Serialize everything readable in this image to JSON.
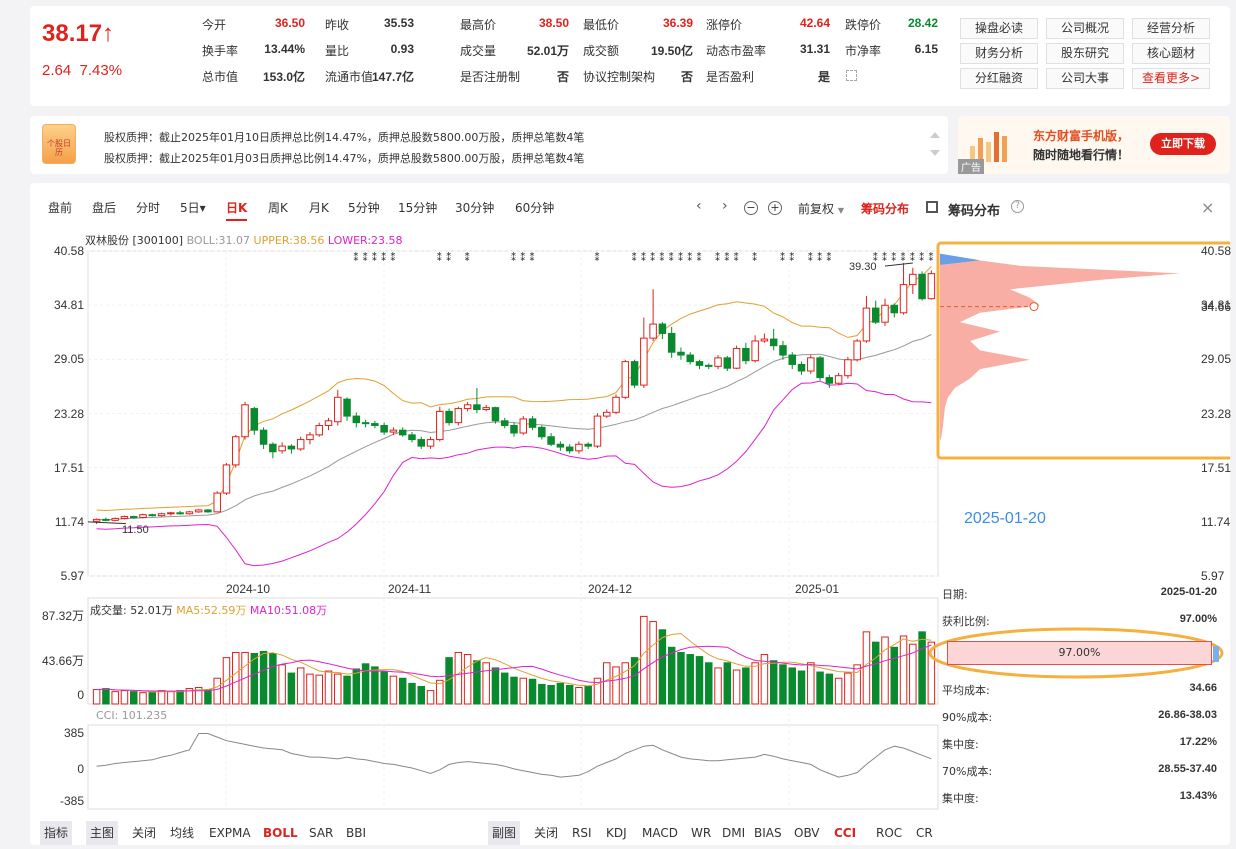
{
  "quote": {
    "price": "38.17↑",
    "change": "2.64",
    "change_pct": "7.43%",
    "items": [
      {
        "label": "今开",
        "value": "36.50",
        "cls": "red"
      },
      {
        "label": "昨收",
        "value": "35.53",
        "cls": ""
      },
      {
        "label": "最高价",
        "value": "38.50",
        "cls": "red"
      },
      {
        "label": "最低价",
        "value": "36.39",
        "cls": "red"
      },
      {
        "label": "涨停价",
        "value": "42.64",
        "cls": "red"
      },
      {
        "label": "跌停价",
        "value": "28.42",
        "cls": "green"
      },
      {
        "label": "换手率",
        "value": "13.44%",
        "cls": ""
      },
      {
        "label": "量比",
        "value": "0.93",
        "cls": ""
      },
      {
        "label": "成交量",
        "value": "52.01万",
        "cls": ""
      },
      {
        "label": "成交额",
        "value": "19.50亿",
        "cls": ""
      },
      {
        "label": "动态市盈率",
        "value": "31.31",
        "cls": ""
      },
      {
        "label": "市净率",
        "value": "6.15",
        "cls": ""
      },
      {
        "label": "总市值",
        "value": "153.0亿",
        "cls": ""
      },
      {
        "label": "流通市值",
        "value": "147.7亿",
        "cls": ""
      },
      {
        "label": "是否注册制",
        "value": "否",
        "cls": ""
      },
      {
        "label": "协议控制架构",
        "value": "否",
        "cls": ""
      },
      {
        "label": "是否盈利",
        "value": "是",
        "cls": ""
      },
      {
        "label": "",
        "value": "",
        "cls": ""
      }
    ]
  },
  "links": [
    "操盘必读",
    "公司概况",
    "经营分析",
    "财务分析",
    "股东研究",
    "核心题材",
    "分红融资",
    "公司大事",
    "查看更多>"
  ],
  "pledge": {
    "icon_text": "个股日历",
    "lines": [
      "股权质押：截止2025年01月10日质押总比例14.47%，质押总股数5800.00万股，质押总笔数4笔",
      "股权质押：截止2025年01月03日质押总比例14.47%，质押总股数5800.00万股，质押总笔数4笔"
    ]
  },
  "ad": {
    "line1": "东方财富手机版，",
    "line2": "随时随地看行情！",
    "button": "立即下载",
    "tag": "广告"
  },
  "periods": [
    "盘前",
    "盘后",
    "分时",
    "5日▾",
    "日K",
    "周K",
    "月K",
    "5分钟",
    "15分钟",
    "30分钟",
    "60分钟"
  ],
  "active_period": "日K",
  "toolbar": {
    "fq": "前复权",
    "chip": "筹码分布",
    "chip_title": "筹码分布",
    "close": "×"
  },
  "legend": {
    "name": "双林股份 [300100]",
    "boll": "BOLL:31.07",
    "upper": "UPPER:38.56",
    "lower": "LOWER:23.58"
  },
  "colors": {
    "up": "#e0221c",
    "down": "#0a8a2e",
    "upper": "#e0a030",
    "mid": "#999999",
    "lower": "#e020d0",
    "ma5": "#e0a030",
    "ma10": "#e020d0"
  },
  "price_axis": [
    "40.58",
    "34.81",
    "29.05",
    "23.28",
    "17.51",
    "11.74",
    "5.97"
  ],
  "date_axis": [
    "2024-10",
    "2024-11",
    "2024-12",
    "2025-01"
  ],
  "annot": {
    "high": "39.30",
    "low": "11.50",
    "chip_date": "2025-01-20",
    "chip_avg": "34.66"
  },
  "vol": {
    "title": "成交量: 52.01万",
    "ma5": "MA5:52.59万",
    "ma10": "MA10:51.08万",
    "axis": [
      "87.32万",
      "43.66万",
      "0"
    ]
  },
  "cci": {
    "title": "CCI: 101.235",
    "axis": [
      "385",
      "0",
      "-385"
    ]
  },
  "chip_stats": [
    {
      "k": "日期:",
      "v": "2025-01-20"
    },
    {
      "k": "获利比例:",
      "v": "97.00%"
    },
    {
      "k": "平均成本:",
      "v": "34.66"
    },
    {
      "k": "90%成本:",
      "v": "26.86-38.03"
    },
    {
      "k": "集中度:",
      "v": "17.22%"
    },
    {
      "k": "70%成本:",
      "v": "28.55-37.40"
    },
    {
      "k": "集中度:",
      "v": "13.43%"
    }
  ],
  "profit_bar": "97.00%",
  "bottom_left": [
    "指标",
    "主图",
    "关闭",
    "均线",
    "EXPMA",
    "BOLL",
    "SAR",
    "BBI"
  ],
  "bottom_right": [
    "副图",
    "关闭",
    "RSI",
    "KDJ",
    "MACD",
    "WR",
    "DMI",
    "BIAS",
    "OBV",
    "CCI",
    "ROC",
    "CR"
  ],
  "bottom_active": [
    "BOLL",
    "CCI"
  ],
  "chart_data": {
    "type": "candlestick",
    "ylim": [
      5.97,
      40.58
    ],
    "candles": [
      [
        11.8,
        12.0,
        11.5,
        12.1
      ],
      [
        12.0,
        11.9,
        11.8,
        12.2
      ],
      [
        11.9,
        12.1,
        11.8,
        12.2
      ],
      [
        12.1,
        12.3,
        12.0,
        12.4
      ],
      [
        12.3,
        12.2,
        12.1,
        12.4
      ],
      [
        12.2,
        12.5,
        12.1,
        12.6
      ],
      [
        12.5,
        12.4,
        12.3,
        12.6
      ],
      [
        12.4,
        12.6,
        12.3,
        12.7
      ],
      [
        12.6,
        12.7,
        12.4,
        12.8
      ],
      [
        12.7,
        12.6,
        12.5,
        12.9
      ],
      [
        12.6,
        12.8,
        12.5,
        12.9
      ],
      [
        12.8,
        13.0,
        12.7,
        13.1
      ],
      [
        13.0,
        12.8,
        12.7,
        13.1
      ],
      [
        12.8,
        14.8,
        12.8,
        15.0
      ],
      [
        14.8,
        17.8,
        14.6,
        18.0
      ],
      [
        17.8,
        20.8,
        17.5,
        21.0
      ],
      [
        20.8,
        24.2,
        20.5,
        24.5
      ],
      [
        23.8,
        21.5,
        21.0,
        24.0
      ],
      [
        21.5,
        20.0,
        19.5,
        21.8
      ],
      [
        20.0,
        19.2,
        18.5,
        20.2
      ],
      [
        19.3,
        19.8,
        19.0,
        20.2
      ],
      [
        19.8,
        19.5,
        19.0,
        20.0
      ],
      [
        19.5,
        20.5,
        19.3,
        20.8
      ],
      [
        20.5,
        21.0,
        20.0,
        21.3
      ],
      [
        21.0,
        22.0,
        20.8,
        22.3
      ],
      [
        22.0,
        22.5,
        21.5,
        22.8
      ],
      [
        22.4,
        25.0,
        22.0,
        25.8
      ],
      [
        24.8,
        23.0,
        22.5,
        25.0
      ],
      [
        23.0,
        22.3,
        21.8,
        23.4
      ],
      [
        22.3,
        22.2,
        21.8,
        22.6
      ],
      [
        22.2,
        22.0,
        21.7,
        22.5
      ],
      [
        22.0,
        21.3,
        21.0,
        22.3
      ],
      [
        21.3,
        21.5,
        21.0,
        21.8
      ],
      [
        21.5,
        21.0,
        20.8,
        21.8
      ],
      [
        21.0,
        20.5,
        20.2,
        21.3
      ],
      [
        20.5,
        19.8,
        19.5,
        20.8
      ],
      [
        19.8,
        20.5,
        19.5,
        20.8
      ],
      [
        20.5,
        23.5,
        20.3,
        24.0
      ],
      [
        23.5,
        22.3,
        22.0,
        23.8
      ],
      [
        22.3,
        23.8,
        22.0,
        24.0
      ],
      [
        23.8,
        24.2,
        23.5,
        24.5
      ],
      [
        24.2,
        23.7,
        23.3,
        26.0
      ],
      [
        23.7,
        23.9,
        23.5,
        24.2
      ],
      [
        23.9,
        22.5,
        22.2,
        24.0
      ],
      [
        22.5,
        22.0,
        21.7,
        22.8
      ],
      [
        22.0,
        21.2,
        20.8,
        22.3
      ],
      [
        21.2,
        22.7,
        21.0,
        23.0
      ],
      [
        22.7,
        21.8,
        21.5,
        23.0
      ],
      [
        21.8,
        20.8,
        20.5,
        22.0
      ],
      [
        20.8,
        20.0,
        19.8,
        21.2
      ],
      [
        20.0,
        19.7,
        19.3,
        20.3
      ],
      [
        19.7,
        19.3,
        19.0,
        20.0
      ],
      [
        19.3,
        20.0,
        19.0,
        20.3
      ],
      [
        20.0,
        19.8,
        19.5,
        20.2
      ],
      [
        19.8,
        23.0,
        19.6,
        23.3
      ],
      [
        23.0,
        23.4,
        22.8,
        23.7
      ],
      [
        23.4,
        25.0,
        23.2,
        25.3
      ],
      [
        25.0,
        28.8,
        24.8,
        29.0
      ],
      [
        28.8,
        26.3,
        26.0,
        29.0
      ],
      [
        26.3,
        31.3,
        26.0,
        33.5
      ],
      [
        31.3,
        32.8,
        31.0,
        36.5
      ],
      [
        32.8,
        31.8,
        31.2,
        33.0
      ],
      [
        31.8,
        29.8,
        29.2,
        32.5
      ],
      [
        29.8,
        29.5,
        29.0,
        30.3
      ],
      [
        29.5,
        28.8,
        28.5,
        29.8
      ],
      [
        28.8,
        28.4,
        28.0,
        29.0
      ],
      [
        28.4,
        28.3,
        28.0,
        28.6
      ],
      [
        28.3,
        29.2,
        28.0,
        29.5
      ],
      [
        29.2,
        28.1,
        27.8,
        29.4
      ],
      [
        28.1,
        30.2,
        28.0,
        30.5
      ],
      [
        30.2,
        28.9,
        28.5,
        30.8
      ],
      [
        28.9,
        31.0,
        28.7,
        31.6
      ],
      [
        31.0,
        31.2,
        30.8,
        31.8
      ],
      [
        31.2,
        30.5,
        30.0,
        32.3
      ],
      [
        30.5,
        29.5,
        29.0,
        31.0
      ],
      [
        29.5,
        28.5,
        28.0,
        29.8
      ],
      [
        28.5,
        27.8,
        27.4,
        28.8
      ],
      [
        27.8,
        29.2,
        27.5,
        29.5
      ],
      [
        29.2,
        27.1,
        26.8,
        29.4
      ],
      [
        27.1,
        26.5,
        26.0,
        27.4
      ],
      [
        26.5,
        27.3,
        26.3,
        27.6
      ],
      [
        27.3,
        29.0,
        27.0,
        29.3
      ],
      [
        29.0,
        31.0,
        28.8,
        31.2
      ],
      [
        31.0,
        34.5,
        30.8,
        35.8
      ],
      [
        34.5,
        33.0,
        32.8,
        35.3
      ],
      [
        33.0,
        34.8,
        32.6,
        35.5
      ],
      [
        34.8,
        34.0,
        33.5,
        35.0
      ],
      [
        34.0,
        37.0,
        33.8,
        39.3
      ],
      [
        37.0,
        38.1,
        36.0,
        38.8
      ],
      [
        38.1,
        35.5,
        35.3,
        38.4
      ],
      [
        35.5,
        38.17,
        35.4,
        38.5
      ]
    ],
    "volume": [
      14,
      15,
      12,
      13,
      12,
      11,
      11,
      13,
      12,
      13,
      15,
      16,
      14,
      25,
      45,
      50,
      50,
      49,
      51,
      49,
      38,
      30,
      35,
      29,
      28,
      32,
      29,
      27,
      34,
      39,
      36,
      31,
      27,
      25,
      20,
      17,
      13,
      23,
      45,
      50,
      48,
      42,
      40,
      35,
      30,
      26,
      25,
      24,
      19,
      18,
      20,
      18,
      16,
      17,
      25,
      40,
      36,
      40,
      45,
      85,
      80,
      72,
      55,
      50,
      48,
      46,
      40,
      35,
      40,
      33,
      35,
      40,
      48,
      42,
      38,
      35,
      32,
      40,
      31,
      29,
      25,
      30,
      38,
      70,
      60,
      65,
      55,
      66,
      58,
      70,
      60
    ],
    "cci": [
      20,
      30,
      50,
      60,
      70,
      80,
      90,
      120,
      140,
      170,
      200,
      380,
      380,
      340,
      300,
      280,
      260,
      240,
      220,
      210,
      200,
      160,
      140,
      120,
      120,
      110,
      100,
      120,
      100,
      90,
      70,
      50,
      40,
      20,
      0,
      -30,
      -60,
      -20,
      40,
      60,
      70,
      60,
      50,
      40,
      20,
      -10,
      -30,
      -50,
      -70,
      -80,
      -100,
      -90,
      -80,
      -40,
      20,
      60,
      100,
      160,
      200,
      240,
      250,
      200,
      160,
      120,
      100,
      90,
      80,
      80,
      90,
      100,
      110,
      120,
      150,
      130,
      100,
      80,
      60,
      40,
      -20,
      -60,
      -100,
      -80,
      -50,
      40,
      120,
      200,
      240,
      220,
      180,
      140,
      101
    ]
  }
}
